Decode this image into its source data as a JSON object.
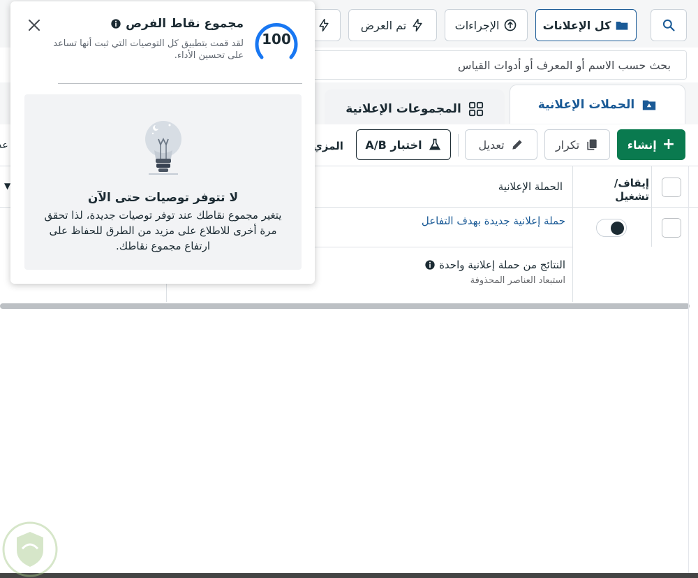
{
  "toolbar": {
    "all_ads_label": "كل الإعلانات",
    "actions_label": "الإجراءات",
    "shown_label": "تم العرض"
  },
  "search": {
    "placeholder": "بحث حسب الاسم أو المعرف أو أدوات القياس"
  },
  "tabs": [
    {
      "label": "الحملات الإعلانية"
    },
    {
      "label": "المجموعات الإعلانية"
    }
  ],
  "actions": {
    "create_label": "إنشاء",
    "duplicate_label": "تكرار",
    "edit_label": "تعديل",
    "ab_test_label": "اختبار A/B",
    "more_label": "المزي",
    "cutoff_label": "عد"
  },
  "table": {
    "col_toggle": "إيقاف/ تشغيل",
    "col_campaign": "الحملة الإعلانية",
    "rows": [
      {
        "campaign": "حملة إعلانية جديدة بهدف التفاعل",
        "on": true
      }
    ],
    "results_label": "النتائج من حملة إعلانية واحدة",
    "exclude_deleted": "استبعاد العناصر المحذوفة"
  },
  "popover": {
    "title": "مجموع نقاط الفرص",
    "description": "لقد قمت بتطبيق كل التوصيات التي ثبت أنها تساعد على تحسين الأداء.",
    "score": "100",
    "empty_title": "لا تتوفر توصيات حتى الآن",
    "empty_body": "يتغير مجموع نقاطك عند توفر توصيات جديدة، لذا تحقق مرة أخرى للاطلاع على مزيد من الطرق للحفاظ على ارتفاع مجموع نقاطك."
  },
  "colors": {
    "accent": "#1a5a96",
    "create": "#0a7a4f",
    "score_ring": "#1877f2"
  }
}
